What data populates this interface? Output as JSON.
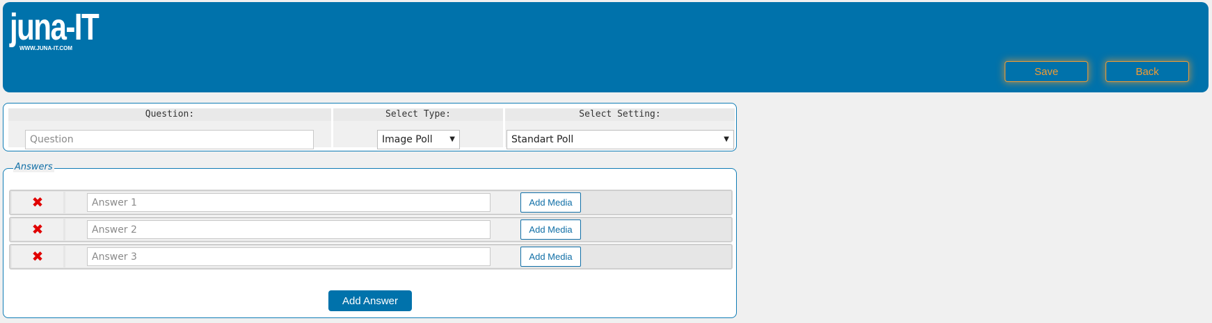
{
  "header": {
    "logo_text": "juna-IT",
    "logo_url": "WWW.JUNA-IT.COM",
    "save_label": "Save",
    "back_label": "Back",
    "colors": {
      "brand": "#0072ab",
      "accent": "#f39c32"
    }
  },
  "question_form": {
    "question_header": "Question:",
    "question_placeholder": "Question",
    "question_value": "",
    "type_header": "Select Type:",
    "type_selected": "Image Poll",
    "setting_header": "Select Setting:",
    "setting_selected": "Standart Poll"
  },
  "answers": {
    "legend": "Answers",
    "items": [
      {
        "placeholder": "Answer 1",
        "value": "",
        "media_label": "Add Media",
        "delete_icon": "close-x-icon"
      },
      {
        "placeholder": "Answer 2",
        "value": "",
        "media_label": "Add Media",
        "delete_icon": "close-x-icon"
      },
      {
        "placeholder": "Answer 3",
        "value": "",
        "media_label": "Add Media",
        "delete_icon": "close-x-icon"
      }
    ],
    "add_answer_label": "Add Answer"
  }
}
